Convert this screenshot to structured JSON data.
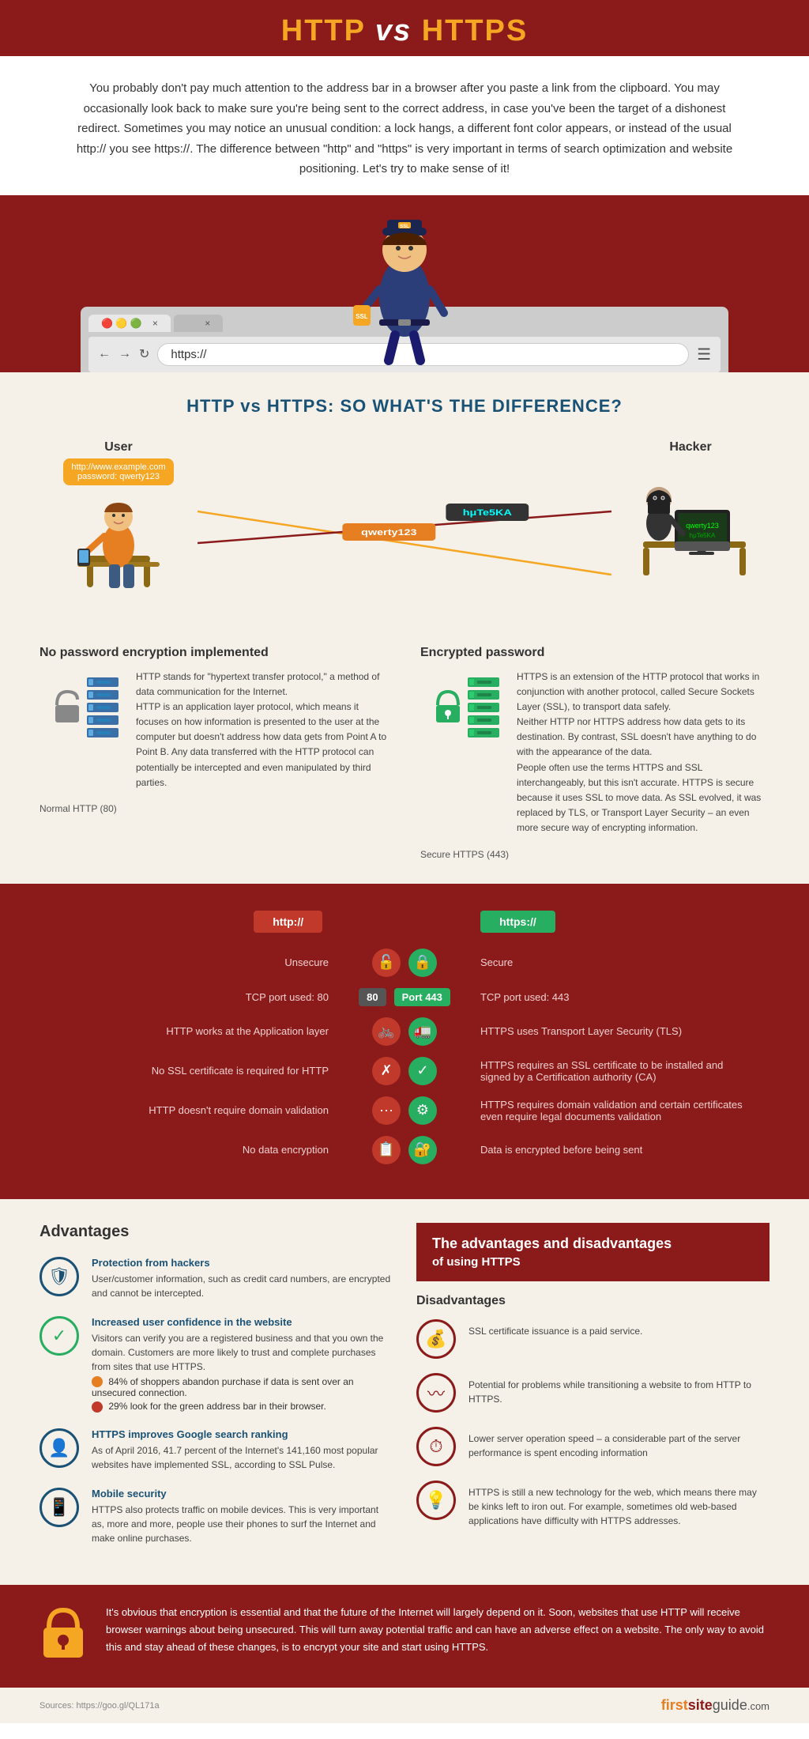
{
  "header": {
    "title_http": "HTTP",
    "title_vs": "vs",
    "title_https": "HTTPS"
  },
  "intro": {
    "text": "You probably don't pay much attention to the address bar in a browser after you paste a link from the clipboard. You may occasionally look back to make sure you're being sent to the correct address, in case you've been the target of a dishonest redirect. Sometimes you may notice an unusual condition: a lock hangs, a different font color appears, or instead of the usual http:// you see https://. The difference between \"http\" and \"https\" is very important in terms of search optimization and website positioning. Let's try to make sense of it!"
  },
  "browser": {
    "address": "https://",
    "tab1": "×",
    "tab2": "×"
  },
  "difference": {
    "section_title": "HTTP vs HTTPS: SO WHAT'S THE DIFFERENCE?",
    "user_label": "User",
    "hacker_label": "Hacker",
    "user_data": "http://www.example.com\npassword: qwerty123",
    "intercepted_data": "qwerty123",
    "hacked_data": "hμTe5KA"
  },
  "no_encryption": {
    "title": "No password encryption implemented",
    "port_label": "Normal HTTP (80)",
    "description": "HTTP stands for \"hypertext transfer protocol,\" a method of data communication for the Internet.\nHTTP is an application layer protocol, which means it focuses on how information is presented to the user at the computer but doesn't address how data gets from Point A to Point B. Any data transferred with the HTTP protocol can potentially be intercepted and even manipulated by third parties."
  },
  "encrypted": {
    "title": "Encrypted password",
    "port_label": "Secure HTTPS (443)",
    "description": "HTTPS is an extension of the HTTP protocol that works in conjunction with another protocol, called Secure Sockets Layer (SSL), to transport data safely.\nNeither HTTP nor HTTPS address how data gets to its destination. By contrast, SSL doesn't have anything to do with the appearance of the data.\nPeople often use the terms HTTPS and SSL interchangeably, but this isn't accurate. HTTPS is secure because it uses SSL to move data. As SSL evolved, it was replaced by TLS, or Transport Layer Security – an even more secure way of encrypting information."
  },
  "table": {
    "http_label": "http://",
    "https_label": "https://",
    "rows": [
      {
        "left": "Unsecure",
        "right": "Secure"
      },
      {
        "left": "TCP port used: 80",
        "port_left": "80",
        "port_right": "443",
        "right": "TCP port used: 443"
      },
      {
        "left": "HTTP works at the Application layer",
        "right": "HTTPS uses Transport Layer Security (TLS)"
      },
      {
        "left": "No SSL certificate is required for HTTP",
        "right": "HTTPS requires an SSL certificate to be installed and signed by a Certification authority (CA)"
      },
      {
        "left": "HTTP doesn't require domain validation",
        "right": "HTTPS requires domain validation and certain certificates even require legal documents validation"
      },
      {
        "left": "No data encryption",
        "right": "Data is encrypted before being sent"
      }
    ]
  },
  "advantages": {
    "title": "Advantages",
    "items": [
      {
        "icon": "🛡",
        "title": "Protection from hackers",
        "text": "User/customer information, such as credit card numbers, are encrypted and cannot be intercepted."
      },
      {
        "icon": "✓",
        "title": "Increased user confidence in the website",
        "text": "Visitors can verify you are a registered business and that you own the domain. Customers are more likely to trust and complete purchases from sites that use HTTPS.",
        "bullets": [
          "84% of shoppers abandon purchase if data is sent over an unsecured connection.",
          "29% look for the green address bar in their browser."
        ]
      },
      {
        "icon": "👤",
        "title": "HTTPS improves Google search ranking",
        "text": "As of April 2016, 41.7 percent of the Internet's 141,160 most popular websites have implemented SSL, according to SSL Pulse."
      },
      {
        "icon": "📱",
        "title": "Mobile security",
        "text": "HTTPS also protects traffic on mobile devices. This is very important as, more and more, people use their phones to surf the Internet and make online purchases."
      }
    ]
  },
  "disadvantages": {
    "main_title": "The advantages and disadvantages",
    "sub_title": "of using HTTPS",
    "section_title": "Disadvantages",
    "items": [
      {
        "icon": "💰",
        "text": "SSL certificate issuance is a paid service."
      },
      {
        "icon": "〰",
        "text": "Potential for problems while transitioning a website to from HTTP to HTTPS."
      },
      {
        "icon": "⏱",
        "text": "Lower server operation speed – a considerable part of the server performance is spent encoding information"
      },
      {
        "icon": "💡",
        "text": "HTTPS is still a new technology for the web, which means there may be kinks left to iron out. For example, sometimes old web-based applications have difficulty with HTTPS addresses."
      }
    ]
  },
  "footer": {
    "text": "It's obvious that encryption is essential and that the future of the Internet will largely depend on it. Soon, websites that use HTTP will receive browser warnings about being unsecured. This will turn away potential traffic and can have an adverse effect on a website. The only way to avoid this and stay ahead of these changes, is to encrypt your site and start using HTTPS.",
    "source": "Sources: https://goo.gl/QL171a",
    "brand_first": "first",
    "brand_site": "site",
    "brand_guide": "guide",
    "brand_com": ".com"
  }
}
